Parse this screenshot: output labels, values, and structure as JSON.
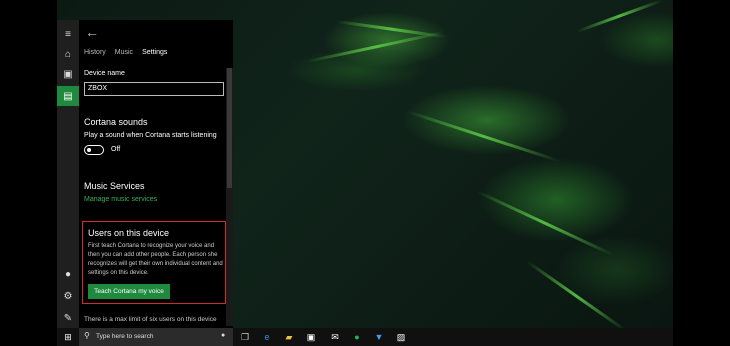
{
  "panel": {
    "back_glyph": "←",
    "tabs": [
      "History",
      "Music",
      "Settings"
    ],
    "device_name": {
      "label": "Device name",
      "value": "ZBOX"
    },
    "cortana_sounds": {
      "heading": "Cortana sounds",
      "description": "Play a sound when Cortana starts listening",
      "toggle_state": "Off"
    },
    "music_services": {
      "heading": "Music Services",
      "link": "Manage music services"
    },
    "users": {
      "heading": "Users on this device",
      "body": "First teach Cortana to recognize your voice and then you can add other people. Each person she recognizes will get their own individual content and settings on this device.",
      "button": "Teach Cortana my voice"
    },
    "note": "There is a max limit of six users on this device"
  },
  "rail": {
    "items": [
      "hamburger-icon",
      "home-icon",
      "notebook-icon",
      "devices-icon"
    ],
    "bottom": [
      "microphone-icon",
      "gear-icon",
      "feedback-icon"
    ]
  },
  "taskbar": {
    "search_placeholder": "Type here to search",
    "apps": [
      "task-view-icon",
      "edge-icon",
      "file-explorer-icon",
      "store-icon",
      "mail-icon",
      "spotify-icon",
      "bookmark-app-icon",
      "photos-icon"
    ]
  },
  "colors": {
    "accent": "#1f8a3e",
    "link": "#35b05a",
    "highlight_box": "#d02a2a"
  }
}
